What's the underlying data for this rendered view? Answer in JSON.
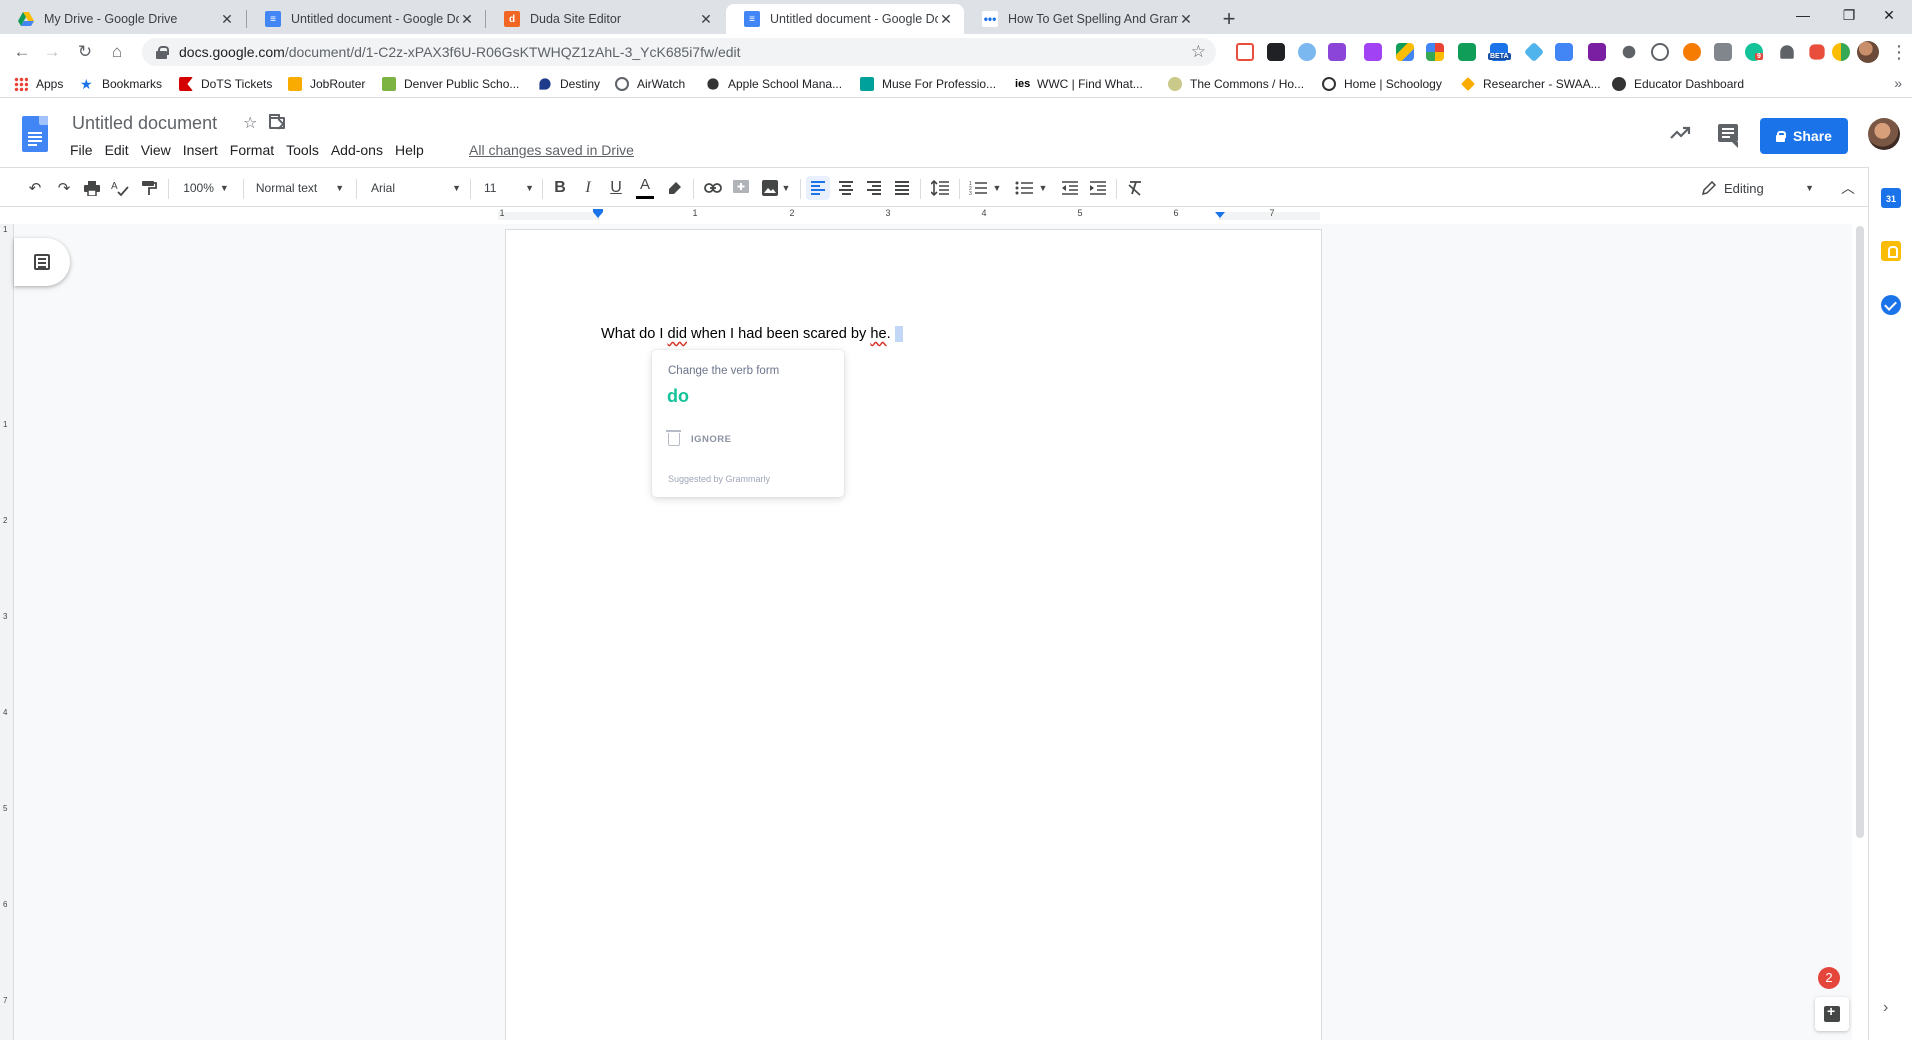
{
  "browser": {
    "tabs": [
      {
        "title": "My Drive - Google Drive",
        "close": "✕",
        "active": false
      },
      {
        "title": "Untitled document - Google Doc",
        "close": "✕",
        "active": false
      },
      {
        "title": "Duda Site Editor",
        "close": "✕",
        "active": false
      },
      {
        "title": "Untitled document - Google Doc",
        "close": "✕",
        "active": true
      },
      {
        "title": "How To Get Spelling And Gramm",
        "close": "✕",
        "active": false
      }
    ],
    "new_tab": "+",
    "window_controls": {
      "minimize": "—",
      "restore": "❐",
      "close": "✕"
    },
    "url_host": "docs.google.com",
    "url_path": "/document/d/1-C2z-xPAX3f6U-R06GsKTWHQZ1zAhL-3_YcK685i7fw/edit",
    "ext_badge_beta": "BETA",
    "ext_badge_count": "9"
  },
  "bookmarks": [
    {
      "label": "Apps",
      "color": "#ea4335"
    },
    {
      "label": "Bookmarks",
      "color": "#1a73e8"
    },
    {
      "label": "DoTS Tickets",
      "color": "#d50000"
    },
    {
      "label": "JobRouter",
      "color": "#f9ab00"
    },
    {
      "label": "Denver Public Scho...",
      "color": "#7cb342"
    },
    {
      "label": "Destiny",
      "color": "#1e3a8a"
    },
    {
      "label": "AirWatch",
      "color": "#5f6368"
    },
    {
      "label": "Apple School Mana...",
      "color": "#333333"
    },
    {
      "label": "Muse For Professio...",
      "color": "#00a19a"
    },
    {
      "label": "WWC | Find What...",
      "color": "#000000"
    },
    {
      "label": "The Commons / Ho...",
      "color": "#8d8d5a"
    },
    {
      "label": "Home | Schoology",
      "color": "#333333"
    },
    {
      "label": "Researcher - SWAA...",
      "color": "#f9ab00"
    },
    {
      "label": "Educator Dashboard",
      "color": "#333333"
    }
  ],
  "docs": {
    "title": "Untitled document",
    "menu": [
      "File",
      "Edit",
      "View",
      "Insert",
      "Format",
      "Tools",
      "Add-ons",
      "Help"
    ],
    "save_status": "All changes saved in Drive",
    "share_label": "Share"
  },
  "toolbar": {
    "zoom": "100%",
    "style": "Normal text",
    "font": "Arial",
    "font_size": "11",
    "bold": "B",
    "italic": "I",
    "underline": "U",
    "text_color": "A",
    "mode": "Editing"
  },
  "ruler": {
    "labels": [
      "1",
      "1",
      "2",
      "3",
      "4",
      "5",
      "6",
      "7"
    ]
  },
  "vruler": {
    "labels": [
      "1",
      "1",
      "2",
      "3",
      "4",
      "5",
      "6",
      "7"
    ]
  },
  "document": {
    "text_before": "What do I ",
    "error_word": "did",
    "text_middle": " when I had been scared by ",
    "error_word2": "he",
    "text_end": "."
  },
  "grammarly": {
    "heading": "Change the verb form",
    "suggestion": "do",
    "ignore": "IGNORE",
    "credit": "Suggested by Grammarly",
    "badge_count": "2"
  },
  "sidepanel": {
    "calendar_label": "31"
  }
}
